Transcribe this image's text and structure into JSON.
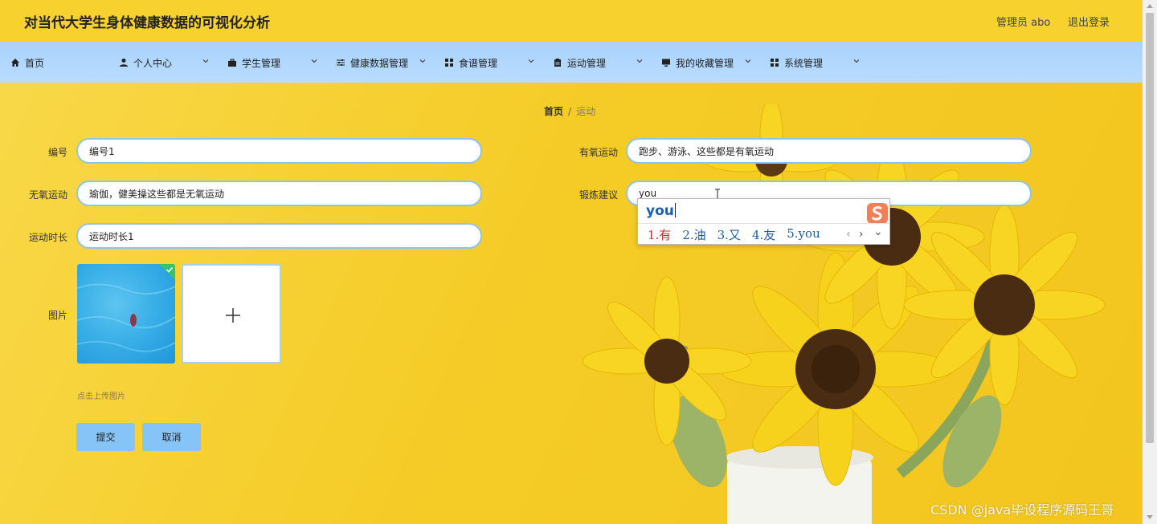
{
  "header": {
    "title": "对当代大学生身体健康数据的可视化分析",
    "admin": "管理员 abo",
    "logout": "退出登录"
  },
  "nav": {
    "home": "首页",
    "personal": "个人中心",
    "students": "学生管理",
    "health": "健康数据管理",
    "recipes": "食谱管理",
    "sports": "运动管理",
    "favorites": "我的收藏管理",
    "system": "系统管理"
  },
  "breadcrumb": {
    "home": "首页",
    "separator": "/",
    "current": "运动"
  },
  "form": {
    "id_label": "编号",
    "id_value": "编号1",
    "aerobic_label": "有氧运动",
    "aerobic_value": "跑步、游泳、这些都是有氧运动",
    "anaerobic_label": "无氧运动",
    "anaerobic_value": "瑜伽，健美操这些都是无氧运动",
    "advice_label": "锻炼建议",
    "advice_value": "you",
    "duration_label": "运动时长",
    "duration_value": "运动时长1",
    "image_label": "图片",
    "upload_hint": "点击上传图片",
    "submit": "提交",
    "cancel": "取消"
  },
  "ime": {
    "composition": "you",
    "candidates": [
      "1.有",
      "2.油",
      "3.又",
      "4.友",
      "5.you"
    ],
    "prev": "‹",
    "next": "›",
    "more": "⌄"
  },
  "watermark": "CSDN @java毕设程序源码王哥",
  "colors": {
    "topbar": "#f7d22f",
    "navbar": "#b9dcff",
    "button": "#86c3f7",
    "input_border": "#8fc3ec",
    "ime_selected": "#d12b2b",
    "ime_candidate": "#1e5fa8"
  }
}
